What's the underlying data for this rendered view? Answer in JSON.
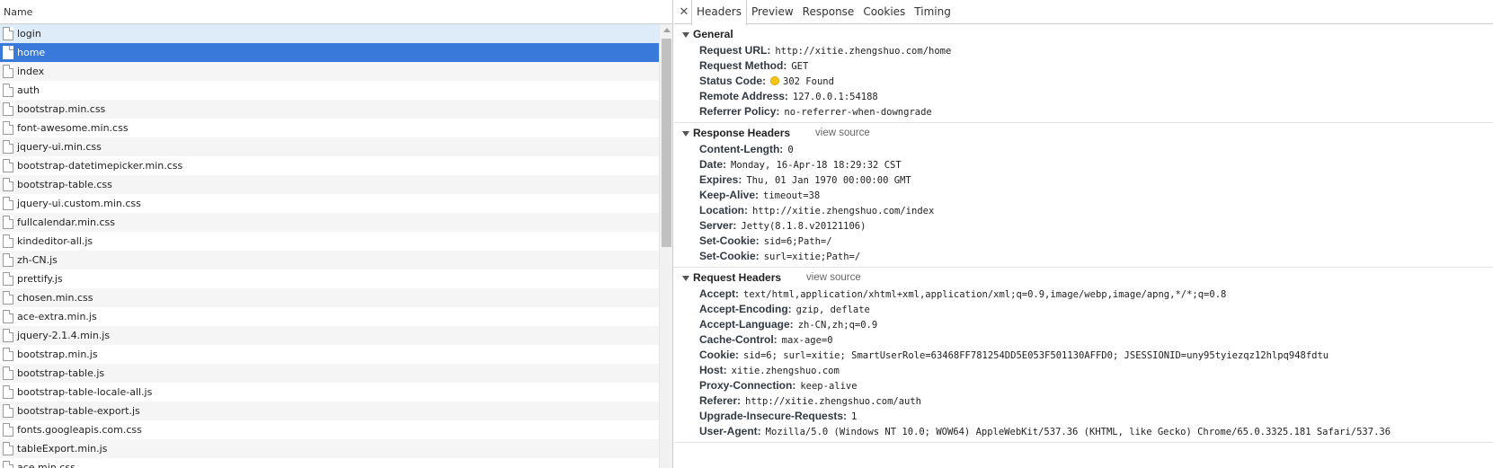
{
  "list": {
    "column_header": "Name",
    "items": [
      "login",
      "home",
      "index",
      "auth",
      "bootstrap.min.css",
      "font-awesome.min.css",
      "jquery-ui.min.css",
      "bootstrap-datetimepicker.min.css",
      "bootstrap-table.css",
      "jquery-ui.custom.min.css",
      "fullcalendar.min.css",
      "kindeditor-all.js",
      "zh-CN.js",
      "prettify.js",
      "chosen.min.css",
      "ace-extra.min.js",
      "jquery-2.1.4.min.js",
      "bootstrap.min.js",
      "bootstrap-table.js",
      "bootstrap-table-locale-all.js",
      "bootstrap-table-export.js",
      "fonts.googleapis.com.css",
      "tableExport.min.js",
      "ace.min.css"
    ],
    "hover_index": 0,
    "selected_index": 1
  },
  "tabs": {
    "close_icon": "close-icon",
    "items": [
      "Headers",
      "Preview",
      "Response",
      "Cookies",
      "Timing"
    ],
    "active_index": 0
  },
  "status_color": "#f5c518",
  "sections": [
    {
      "id": "general",
      "title": "General",
      "view_source": "",
      "rows": [
        {
          "key": "Request URL:",
          "value": "http://xitie.zhengshuo.com/home"
        },
        {
          "key": "Request Method:",
          "value": "GET"
        },
        {
          "key": "Status Code:",
          "value": "302 Found",
          "status_dot": true
        },
        {
          "key": "Remote Address:",
          "value": "127.0.0.1:54188"
        },
        {
          "key": "Referrer Policy:",
          "value": "no-referrer-when-downgrade"
        }
      ]
    },
    {
      "id": "response-headers",
      "title": "Response Headers",
      "view_source": "view source",
      "rows": [
        {
          "key": "Content-Length:",
          "value": "0"
        },
        {
          "key": "Date:",
          "value": "Monday, 16-Apr-18 18:29:32 CST"
        },
        {
          "key": "Expires:",
          "value": "Thu, 01 Jan 1970 00:00:00 GMT"
        },
        {
          "key": "Keep-Alive:",
          "value": "timeout=38"
        },
        {
          "key": "Location:",
          "value": "http://xitie.zhengshuo.com/index"
        },
        {
          "key": "Server:",
          "value": "Jetty(8.1.8.v20121106)"
        },
        {
          "key": "Set-Cookie:",
          "value": "sid=6;Path=/"
        },
        {
          "key": "Set-Cookie:",
          "value": "surl=xitie;Path=/"
        }
      ]
    },
    {
      "id": "request-headers",
      "title": "Request Headers",
      "view_source": "view source",
      "rows": [
        {
          "key": "Accept:",
          "value": "text/html,application/xhtml+xml,application/xml;q=0.9,image/webp,image/apng,*/*;q=0.8"
        },
        {
          "key": "Accept-Encoding:",
          "value": "gzip, deflate"
        },
        {
          "key": "Accept-Language:",
          "value": "zh-CN,zh;q=0.9"
        },
        {
          "key": "Cache-Control:",
          "value": "max-age=0"
        },
        {
          "key": "Cookie:",
          "value": "sid=6; surl=xitie; SmartUserRole=63468FF781254DD5E053F501130AFFD0; JSESSIONID=uny95tyiezqz12hlpq948fdtu"
        },
        {
          "key": "Host:",
          "value": "xitie.zhengshuo.com"
        },
        {
          "key": "Proxy-Connection:",
          "value": "keep-alive"
        },
        {
          "key": "Referer:",
          "value": "http://xitie.zhengshuo.com/auth"
        },
        {
          "key": "Upgrade-Insecure-Requests:",
          "value": "1"
        },
        {
          "key": "User-Agent:",
          "value": "Mozilla/5.0 (Windows NT 10.0; WOW64) AppleWebKit/537.36 (KHTML, like Gecko) Chrome/65.0.3325.181 Safari/537.36"
        }
      ]
    }
  ]
}
